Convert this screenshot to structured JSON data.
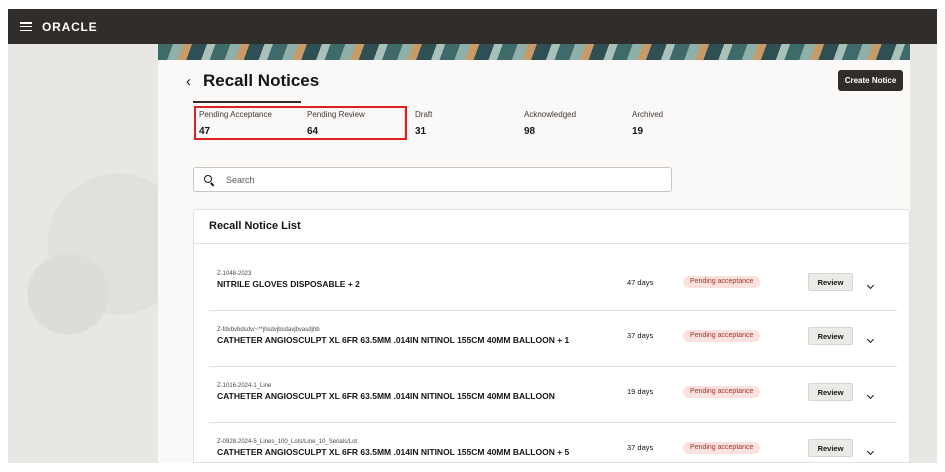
{
  "header": {
    "brand": "ORACLE",
    "menu_icon": "hamburger-icon"
  },
  "page": {
    "title": "Recall Notices",
    "back_icon": "chevron-left-icon",
    "create_label": "Create Notice"
  },
  "stats": [
    {
      "label": "Pending Acceptance",
      "value": "47"
    },
    {
      "label": "Pending Review",
      "value": "64"
    },
    {
      "label": "Draft",
      "value": "31"
    },
    {
      "label": "Acknowledged",
      "value": "98"
    },
    {
      "label": "Archived",
      "value": "19"
    }
  ],
  "search": {
    "placeholder": "Search",
    "icon": "search-icon"
  },
  "list": {
    "title": "Recall Notice List",
    "rows": [
      {
        "id": "Z-1048-2023",
        "name": "NITRILE GLOVES DISPOSABLE + 2",
        "days": "47 days",
        "status": "Pending acceptance",
        "action": "Review"
      },
      {
        "id": "Z-fdvbvbdsdv/~**jhsdvjbsdavjbvasdjhb",
        "name": "CATHETER ANGIOSCULPT XL 6FR 63.5MM .014IN NITINOL 155CM 40MM BALLOON + 1",
        "days": "37 days",
        "status": "Pending acceptance",
        "action": "Review"
      },
      {
        "id": "Z-1016-2024-1_Line",
        "name": "CATHETER ANGIOSCULPT XL 6FR 63.5MM .014IN NITINOL 155CM 40MM BALLOON",
        "days": "19 days",
        "status": "Pending acceptance",
        "action": "Review"
      },
      {
        "id": "Z-0928-2024-5_Lines_100_Lots/Line_10_Serials/Lot",
        "name": "CATHETER ANGIOSCULPT XL 6FR 63.5MM .014IN NITINOL 155CM 40MM BALLOON + 5",
        "days": "37 days",
        "status": "Pending acceptance",
        "action": "Review"
      }
    ]
  },
  "colors": {
    "topbar": "#312d2a",
    "highlight": "#e0201e",
    "badge_bg": "#fbe2df",
    "badge_text": "#a7322a"
  }
}
